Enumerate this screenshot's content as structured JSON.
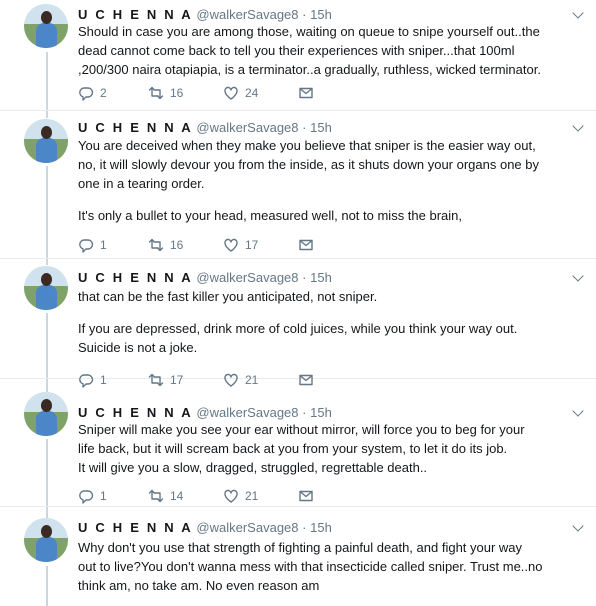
{
  "tweets": [
    {
      "name": "U C H E N N A",
      "handle": "@walkerSavage8",
      "dot": "·",
      "time": "15h",
      "lines": [
        "Should in case you are among those, waiting on queue to snipe yourself out..the",
        "dead cannot come back to tell you their experiences with sniper...that 100ml",
        ",200/300 naira otapiapia, is a terminator..a gradually, ruthless, wicked terminator."
      ],
      "paragraph2": [],
      "replies": "2",
      "retweets": "16",
      "likes": "24"
    },
    {
      "name": "U C H E N N A",
      "handle": "@walkerSavage8",
      "dot": "·",
      "time": "15h",
      "lines": [
        "You are deceived when they make you believe that sniper is the easier way out,",
        "no, it will slowly devour you from the inside, as it shuts down your organs one by",
        "one in a tearing order."
      ],
      "paragraph2": [
        "It's only a bullet to your head, measured well, not to miss the brain,"
      ],
      "replies": "1",
      "retweets": "16",
      "likes": "17"
    },
    {
      "name": "U C H E N N A",
      "handle": "@walkerSavage8",
      "dot": "·",
      "time": "15h",
      "lines": [
        "that can be the fast killer you anticipated, not sniper."
      ],
      "paragraph2": [
        "If you are depressed, drink more of cold juices, while you think your way out.",
        "Suicide is not a joke."
      ],
      "replies": "1",
      "retweets": "17",
      "likes": "21"
    },
    {
      "name": "U C H E N N A",
      "handle": "@walkerSavage8",
      "dot": "·",
      "time": "15h",
      "lines": [
        "Sniper will make you see your ear without mirror, will force you to beg for your",
        "life back, but it will scream back at you from your system, to let it do its job.",
        "It will give you a slow, dragged, struggled, regrettable death.."
      ],
      "paragraph2": [],
      "replies": "1",
      "retweets": "14",
      "likes": "21"
    },
    {
      "name": "U C H E N N A",
      "handle": "@walkerSavage8",
      "dot": "·",
      "time": "15h",
      "lines": [
        "Why don't you use that strength of fighting a painful death, and fight your way",
        "out to live?You don't wanna mess with that insecticide called sniper. Trust me..no",
        "think am, no take am. No even reason am"
      ],
      "paragraph2": [],
      "replies": null,
      "retweets": null,
      "likes": null
    }
  ],
  "icons": {
    "reply": "reply-icon",
    "retweet": "retweet-icon",
    "like": "heart-icon",
    "dm": "envelope-icon",
    "more": "chevron-down-icon"
  },
  "colors": {
    "text": "#14171a",
    "secondary": "#657786",
    "thread_line": "#ccd6dd",
    "divider": "#e6ecf0"
  }
}
